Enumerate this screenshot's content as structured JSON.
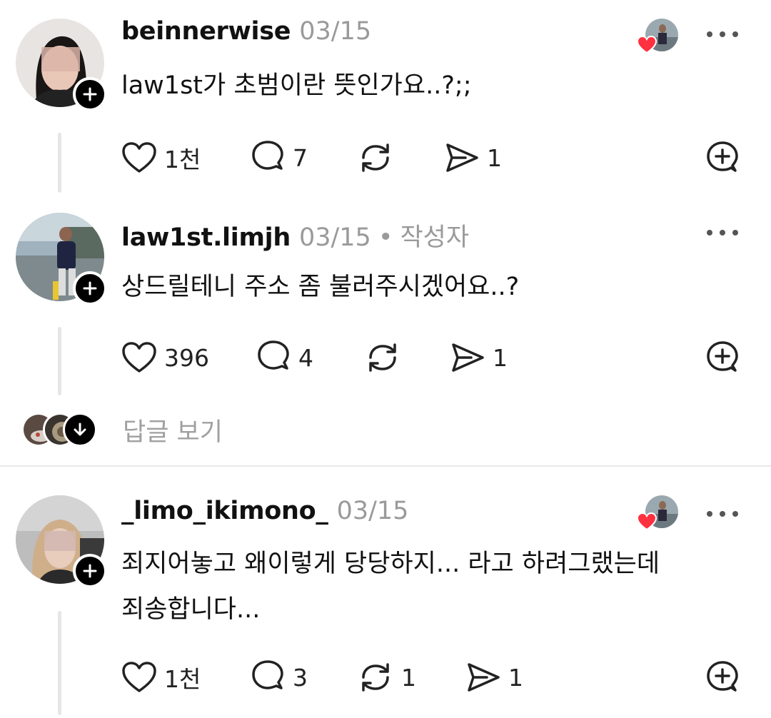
{
  "posts": [
    {
      "username": "beinnerwise",
      "date": "03/15",
      "author_tag": "",
      "text_lines": [
        "law1st가 초범이란 뜻인가요..?;;"
      ],
      "likes": "1천",
      "comments": "7",
      "reposts": "",
      "shares": "1",
      "liked_by_author": true
    },
    {
      "username": "law1st.limjh",
      "date": "03/15",
      "author_tag": "작성자",
      "text_lines": [
        "상드릴테니 주소 좀 불러주시겠어요..?"
      ],
      "likes": "396",
      "comments": "4",
      "reposts": "",
      "shares": "1",
      "liked_by_author": false
    },
    {
      "username": "_limo_ikimono_",
      "date": "03/15",
      "author_tag": "",
      "text_lines": [
        "죄지어놓고 왜이렇게 당당하지... 라고 하려그랬는데",
        "죄송합니다..."
      ],
      "likes": "1천",
      "comments": "3",
      "reposts": "1",
      "shares": "1",
      "liked_by_author": true
    }
  ],
  "view_replies_label": "답글 보기",
  "separator": "•",
  "icons": {
    "like": "heart-outline-icon",
    "comment": "speech-bubble-icon",
    "repost": "repost-arrows-icon",
    "share": "paper-plane-icon",
    "quote": "add-comment-icon",
    "more": "more-dots-icon",
    "follow": "plus-icon"
  },
  "colors": {
    "heart_red": "#ff3040",
    "muted_text": "#9a9a9a",
    "icon": "#222222"
  }
}
